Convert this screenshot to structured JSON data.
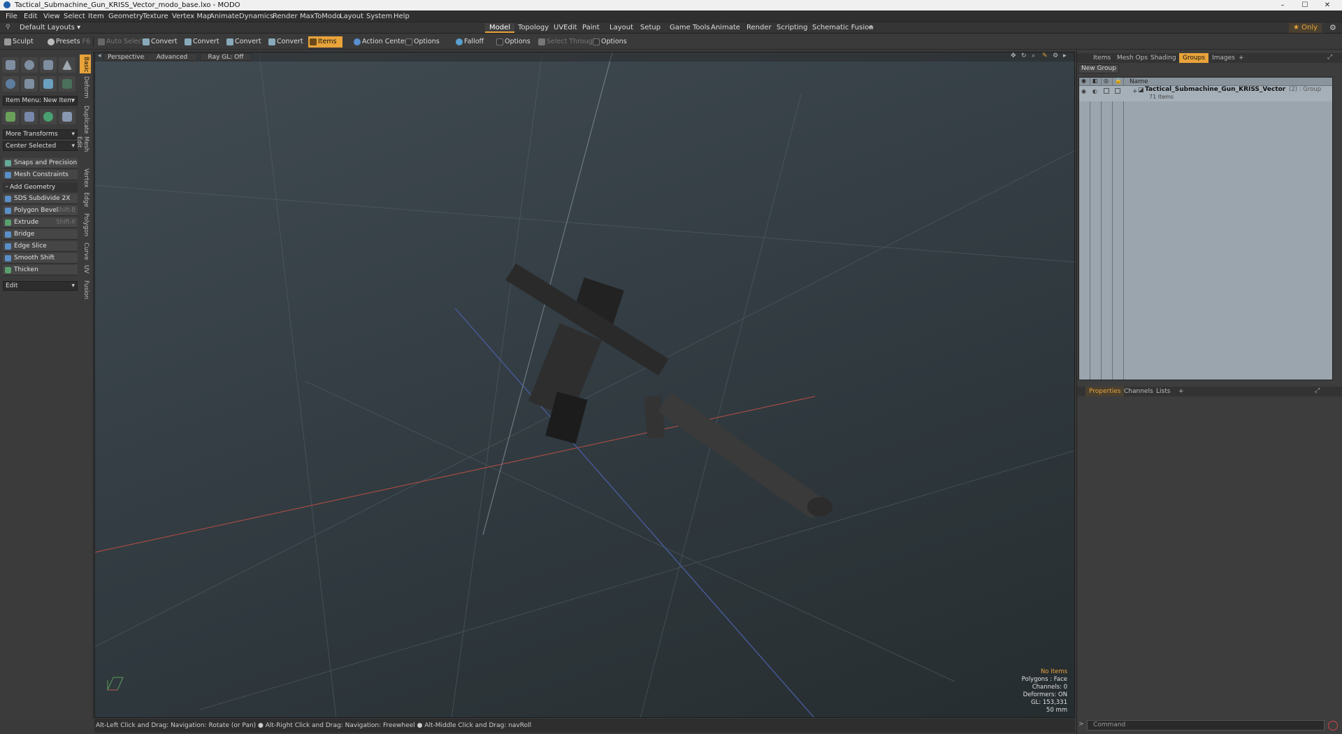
{
  "window": {
    "title": "Tactical_Submachine_Gun_KRISS_Vector_modo_base.lxo - MODO",
    "minimize": "–",
    "maximize": "☐",
    "close": "✕"
  },
  "menu": [
    "File",
    "Edit",
    "View",
    "Select",
    "Item",
    "Geometry",
    "Texture",
    "Vertex Map",
    "Animate",
    "Dynamics",
    "Render",
    "MaxToModo",
    "Layout",
    "System",
    "Help"
  ],
  "layoutbar": {
    "layouts": "Default Layouts ▾",
    "tabs": [
      "Model",
      "Topology",
      "UVEdit",
      "Paint",
      "Layout",
      "Setup",
      "Game Tools",
      "Animate",
      "Render",
      "Scripting",
      "Schematic Fusion"
    ],
    "add": "+",
    "only": "★ Only"
  },
  "toolbar": {
    "sculpt": "Sculpt",
    "presets": "Presets",
    "presets_key": "F6",
    "auto_select": "Auto Select",
    "convert": "Convert",
    "items": "Items",
    "action_center": "Action Center",
    "options": "Options",
    "falloff": "Falloff",
    "select_through": "Select Through"
  },
  "vtabs": [
    "Basic",
    "Deform",
    "Duplicate",
    "Mesh Edit",
    "Vertex",
    "Edge",
    "Polygon",
    "Curve",
    "UV",
    "Fusion"
  ],
  "left": {
    "item_menu": "Item Menu: New Item",
    "more_transforms": "More Transforms",
    "center_selected": "Center Selected",
    "snaps": "Snaps and Precision",
    "constraints": "Mesh Constraints",
    "add_geometry": "Add Geometry",
    "tools": [
      {
        "label": "SDS Subdivide 2X",
        "shortcut": ""
      },
      {
        "label": "Polygon Bevel",
        "shortcut": "Shift-B"
      },
      {
        "label": "Extrude",
        "shortcut": "Shift-X"
      },
      {
        "label": "Bridge",
        "shortcut": ""
      },
      {
        "label": "Edge Slice",
        "shortcut": ""
      },
      {
        "label": "Smooth Shift",
        "shortcut": ""
      },
      {
        "label": "Thicken",
        "shortcut": ""
      }
    ],
    "edit": "Edit"
  },
  "viewport": {
    "view": "Perspective",
    "shading": "Advanced",
    "raygl": "Ray GL: Off",
    "stats": [
      "No Items",
      "Polygons : Face",
      "Channels: 0",
      "Deformers: ON",
      "GL: 153,331",
      "50 mm"
    ]
  },
  "status": "Alt-Left Click and Drag: Navigation: Rotate (or Pan) ● Alt-Right Click and Drag: Navigation: Freewheel ● Alt-Middle Click and Drag: navRoll",
  "right": {
    "tabs": [
      "Items",
      "Mesh Ops",
      "Shading",
      "Groups",
      "Images"
    ],
    "new_group": "New Group",
    "col_name": "Name",
    "group_name": "Tactical_Submachine_Gun_KRISS_Vector",
    "group_suffix": "(2) : Group",
    "group_items": "71 Items",
    "lower_tabs": [
      "Properties",
      "Channels",
      "Lists"
    ],
    "command": "Command"
  },
  "colors": {
    "accent": "#e8a33a",
    "viewport": "#333d43"
  }
}
